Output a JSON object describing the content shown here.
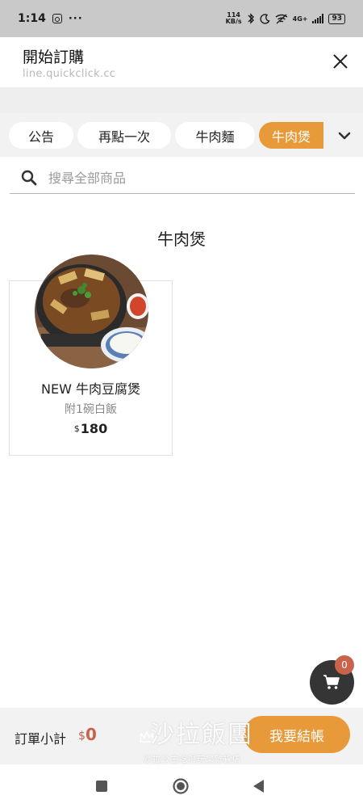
{
  "status_bar": {
    "time": "1:14",
    "more": "···",
    "net_speed_value": "114",
    "net_speed_unit": "KB/s",
    "network": "4G+",
    "battery": "93"
  },
  "header": {
    "title": "開始訂購",
    "subtitle": "line.quickclick.cc"
  },
  "tabs": [
    {
      "label": "公告",
      "active": false
    },
    {
      "label": "再點一次",
      "active": false
    },
    {
      "label": "牛肉麵",
      "active": false
    },
    {
      "label": "牛肉煲",
      "active": true
    }
  ],
  "search": {
    "placeholder": "搜尋全部商品",
    "value": ""
  },
  "section": {
    "title": "牛肉煲"
  },
  "products": [
    {
      "name": "NEW 牛肉豆腐煲",
      "description": "附1碗白飯",
      "currency": "$",
      "price": "180"
    }
  ],
  "cart": {
    "count": "0"
  },
  "footer": {
    "subtotal_label": "訂單小計",
    "subtotal_currency": "$",
    "subtotal_value": "0",
    "checkout_label": "我要結帳"
  },
  "watermark": {
    "main": "沙拉飯團",
    "sub": "沙拉公主吃喝玩樂雜貨店"
  },
  "colors": {
    "accent": "#e8993a",
    "price_red": "#c9644c",
    "cart_dark": "#353535"
  }
}
